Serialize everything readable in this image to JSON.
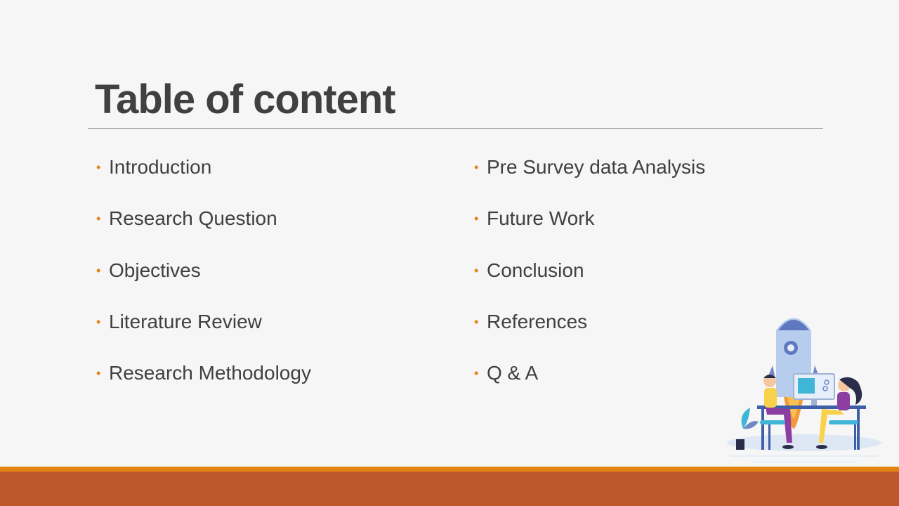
{
  "slide": {
    "title": "Table of content",
    "left_items": [
      "Introduction",
      "Research Question",
      "Objectives",
      "Literature Review",
      "Research Methodology"
    ],
    "right_items": [
      "Pre Survey data Analysis",
      "Future Work",
      "Conclusion",
      "References",
      "Q & A"
    ]
  },
  "colors": {
    "background": "#f6f6f6",
    "text": "#404040",
    "bullet": "#e48312",
    "accent_bar": "#e48312",
    "footer_bar": "#bd582c"
  },
  "icons": {
    "bullet": "bullet-dot-icon",
    "illustration": "rocket-team-illustration-icon"
  }
}
